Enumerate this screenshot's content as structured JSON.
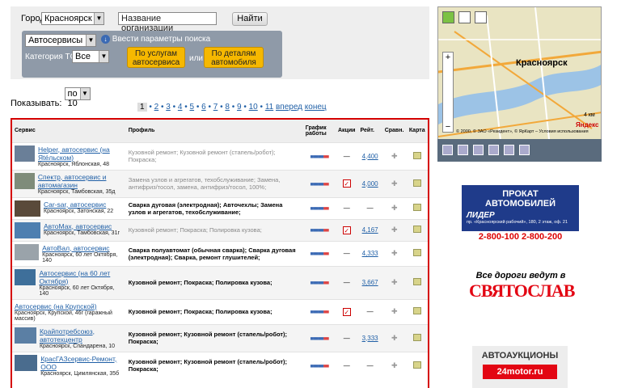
{
  "search": {
    "city_label": "Город",
    "city_value": "Красноярск",
    "org_placeholder": "Название организации",
    "find_button": "Найти",
    "type_value": "Автосервисы",
    "advanced_link": "Ввести параметры поиска",
    "vehicle_label": "Категория ТС",
    "vehicle_value": "Все",
    "btn_services": "По услугам автосервиса",
    "or_label": "или",
    "btn_parts": "По деталям автомобиля"
  },
  "show": {
    "label": "Показывать:",
    "value": "по 10"
  },
  "pager": {
    "current": "1",
    "pages": [
      "2",
      "3",
      "4",
      "5",
      "6",
      "7",
      "8",
      "9",
      "10",
      "11"
    ],
    "next": "вперед",
    "last": "конец"
  },
  "table": {
    "headers": {
      "service": "Сервис",
      "profile": "Профиль",
      "schedule": "График работы",
      "promo": "Акции",
      "rating": "Рейт.",
      "compare": "Сравн.",
      "map": "Карта"
    },
    "rows": [
      {
        "name": "Helper, автосервис (на Яtéльском)",
        "addr": "Красноярск, Яблонская, 48",
        "profile": "Кузовной ремонт; Кузовной ремонт (стапель/робот); Покраска;",
        "bold": false,
        "promo": "—",
        "rating": "4,400",
        "thumb": "#6a7f98"
      },
      {
        "name": "Спектр, автосервис и автомагазин",
        "addr": "Красноярск, Тамбовская, 35д",
        "profile": "Замена узлов и агрегатов, техобслуживание; Замена, антифриз/тосол, замена, антифриз/тосол, 100%;",
        "bold": false,
        "promo": "check",
        "rating": "4,000",
        "thumb": "#7f8c7a"
      },
      {
        "name": "Car-sar, автосервис",
        "addr": "Красноярск, Затонская, 22",
        "profile": "Сварка дуговая (электродная); Авточехлы; Замена узлов и агрегатов, техобслуживание;",
        "bold": true,
        "promo": "—",
        "rating": "—",
        "thumb": "#5a4a3a"
      },
      {
        "name": "АвтоМах, автосервис",
        "addr": "Красноярск, Тамбовская, 31г",
        "profile": "Кузовной ремонт; Покраска; Полировка кузова;",
        "bold": false,
        "promo": "check",
        "rating": "4,167",
        "thumb": "#4e7fb0"
      },
      {
        "name": "АвтоВал, автосервис",
        "addr": "Красноярск, 60 лет Октября, 140",
        "profile": "Сварка полуавтомат (обычная сварка); Сварка дуговая (электродная); Сварка, ремонт глушителей;",
        "bold": true,
        "promo": "—",
        "rating": "4,333",
        "thumb": "#9aa3aa"
      },
      {
        "name": "Автосервис (на 60 лет Октября)",
        "addr": "Красноярск, 60 лет Октября, 140",
        "profile": "Кузовной ремонт; Покраска; Полировка кузова;",
        "bold": true,
        "promo": "—",
        "rating": "3,667",
        "thumb": "#3e6f9a"
      },
      {
        "name": "Автосервис (на Крупской)",
        "addr": "Красноярск, Крупской, 46г (гаражный массив)",
        "profile": "Кузовной ремонт; Покраска; Полировка кузова;",
        "bold": true,
        "promo": "check",
        "rating": "—",
        "thumb": ""
      },
      {
        "name": "Крайпотребсоюз, автотехцентр",
        "addr": "Красноярск, Спандарена, 10",
        "profile": "Кузовной ремонт; Кузовной ремонт (стапель/робот); Покраска;",
        "bold": true,
        "promo": "—",
        "rating": "3,333",
        "thumb": "#5b7fa4"
      },
      {
        "name": "КрасГАЗсервис-Ремонт, ООО",
        "addr": "Красноярск, Цимлянская, 35б",
        "profile": "Кузовной ремонт; Кузовной ремонт (стапель/робот); Покраска;",
        "bold": true,
        "promo": "—",
        "rating": "—",
        "thumb": "#4a6c8e"
      }
    ]
  },
  "map": {
    "city_label": "Красноярск",
    "scale": "4 км",
    "copyright": "© 2000, © ЗАО «Резидент», © ЯрКарт – Условия использования",
    "brand": "Яндекс"
  },
  "banners": {
    "rent_title1": "ПРОКАТ",
    "rent_title2": "АВТОМОБИЛЕЙ",
    "rent_brand": "ЛИДЕР",
    "rent_addr": "пр. «Красноярский рабочий», 180, 2 этаж, оф. 21",
    "rent_phone1": "2-800-100",
    "rent_phone2": "2-800-200",
    "svyat_slogan": "Все дороги ведут в",
    "svyat_brand": "СВЯТОСЛАВ",
    "auction_title": "АВТОАУКЦИОНЫ",
    "auction_brand": "24motor.ru"
  }
}
